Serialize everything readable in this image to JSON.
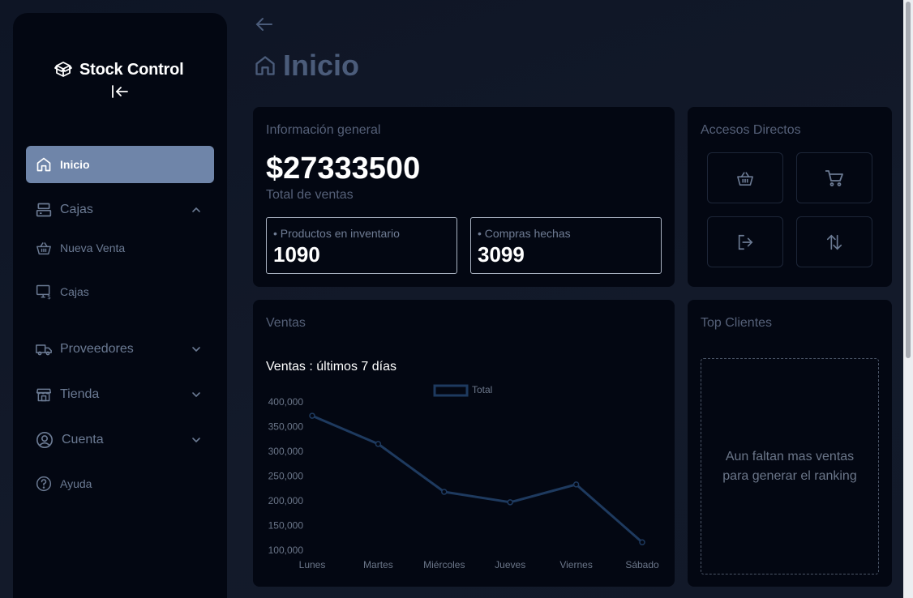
{
  "app": {
    "name": "Stock Control"
  },
  "sidebar": {
    "items": [
      {
        "label": "Inicio"
      },
      {
        "label": "Cajas"
      },
      {
        "label": "Nueva Venta"
      },
      {
        "label": "Cajas"
      },
      {
        "label": "Proveedores"
      },
      {
        "label": "Tienda"
      },
      {
        "label": "Cuenta"
      },
      {
        "label": "Ayuda"
      }
    ]
  },
  "page": {
    "title": "Inicio"
  },
  "info": {
    "title": "Información general",
    "total": "$27333500",
    "total_label": "Total de ventas",
    "stats": [
      {
        "label": "Productos en inventario",
        "value": "1090"
      },
      {
        "label": "Compras hechas",
        "value": "3099"
      }
    ]
  },
  "shortcuts": {
    "title": "Accesos Directos",
    "icons": [
      "basket-icon",
      "cart-icon",
      "logout-icon",
      "arrows-updown-icon"
    ]
  },
  "sales": {
    "title": "Ventas",
    "chart_title": "Ventas : últimos 7 días"
  },
  "top_clients": {
    "title": "Top Clientes",
    "empty_message": "Aun faltan mas ventas para generar el ranking"
  },
  "colors": {
    "accent": "#6f85a9",
    "card": "#030712",
    "line": "#1e3a5f"
  },
  "chart_data": {
    "type": "line",
    "title": "Ventas : últimos 7 días",
    "categories": [
      "Lunes",
      "Martes",
      "Miércoles",
      "Jueves",
      "Viernes",
      "Sábado"
    ],
    "series": [
      {
        "name": "Total",
        "values": [
          372000,
          315000,
          218000,
          197000,
          233000,
          116000
        ]
      }
    ],
    "y_ticks": [
      "400,000",
      "350,000",
      "300,000",
      "250,000",
      "200,000",
      "150,000",
      "100,000"
    ],
    "ylim": [
      100000,
      400000
    ],
    "legend": "top-center",
    "grid": false
  }
}
